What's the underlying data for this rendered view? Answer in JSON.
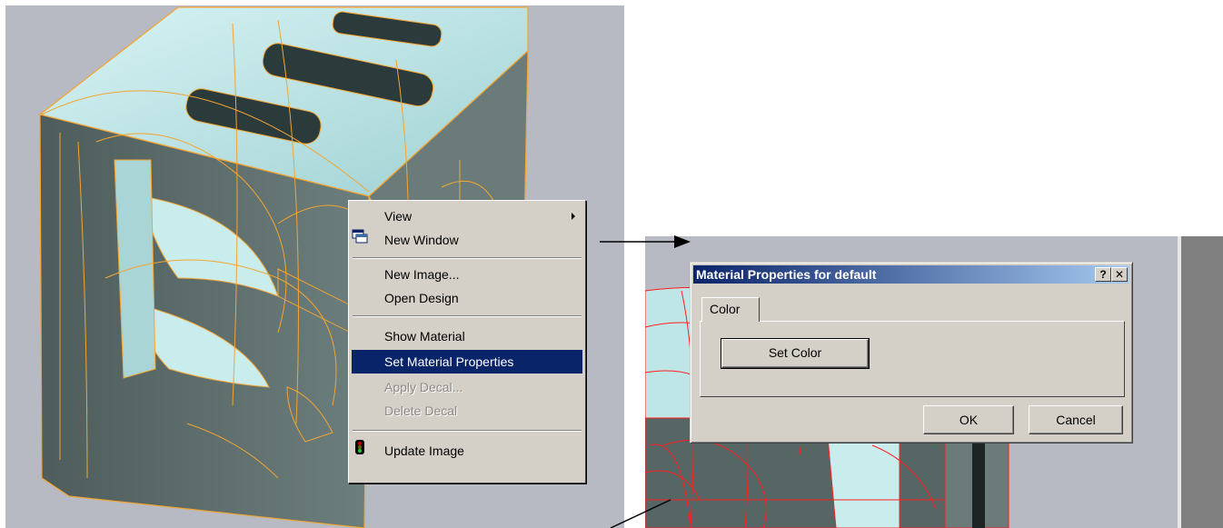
{
  "context_menu": {
    "items": [
      {
        "label": "View",
        "state": "normal",
        "has_submenu": true
      },
      {
        "label": "New Window",
        "state": "normal",
        "icon": "new-window-icon"
      },
      {
        "label": "New Image...",
        "state": "normal"
      },
      {
        "label": "Open Design",
        "state": "normal"
      },
      {
        "label": "Show Material",
        "state": "normal"
      },
      {
        "label": "Set Material Properties",
        "state": "highlighted"
      },
      {
        "label": "Apply Decal...",
        "state": "disabled"
      },
      {
        "label": "Delete Decal",
        "state": "disabled"
      },
      {
        "label": "Update Image",
        "state": "normal",
        "icon": "traffic-light-icon"
      }
    ]
  },
  "dialog": {
    "title": "Material Properties for default",
    "help_button": "?",
    "close_button": "✕",
    "tabs": [
      {
        "label": "Color",
        "selected": true
      }
    ],
    "set_color_label": "Set Color",
    "ok_label": "OK",
    "cancel_label": "Cancel"
  },
  "colors": {
    "viewport_bg": "#b7b9c3",
    "model_wire_left": "#f3a531",
    "model_wire_right": "#ff1e1e",
    "model_top_face": "#bfe6e7",
    "model_side_face": "#5e6f6e",
    "menu_highlight": "#0a246a",
    "title_gradient_start": "#0a246a",
    "title_gradient_end": "#a6caf0"
  }
}
